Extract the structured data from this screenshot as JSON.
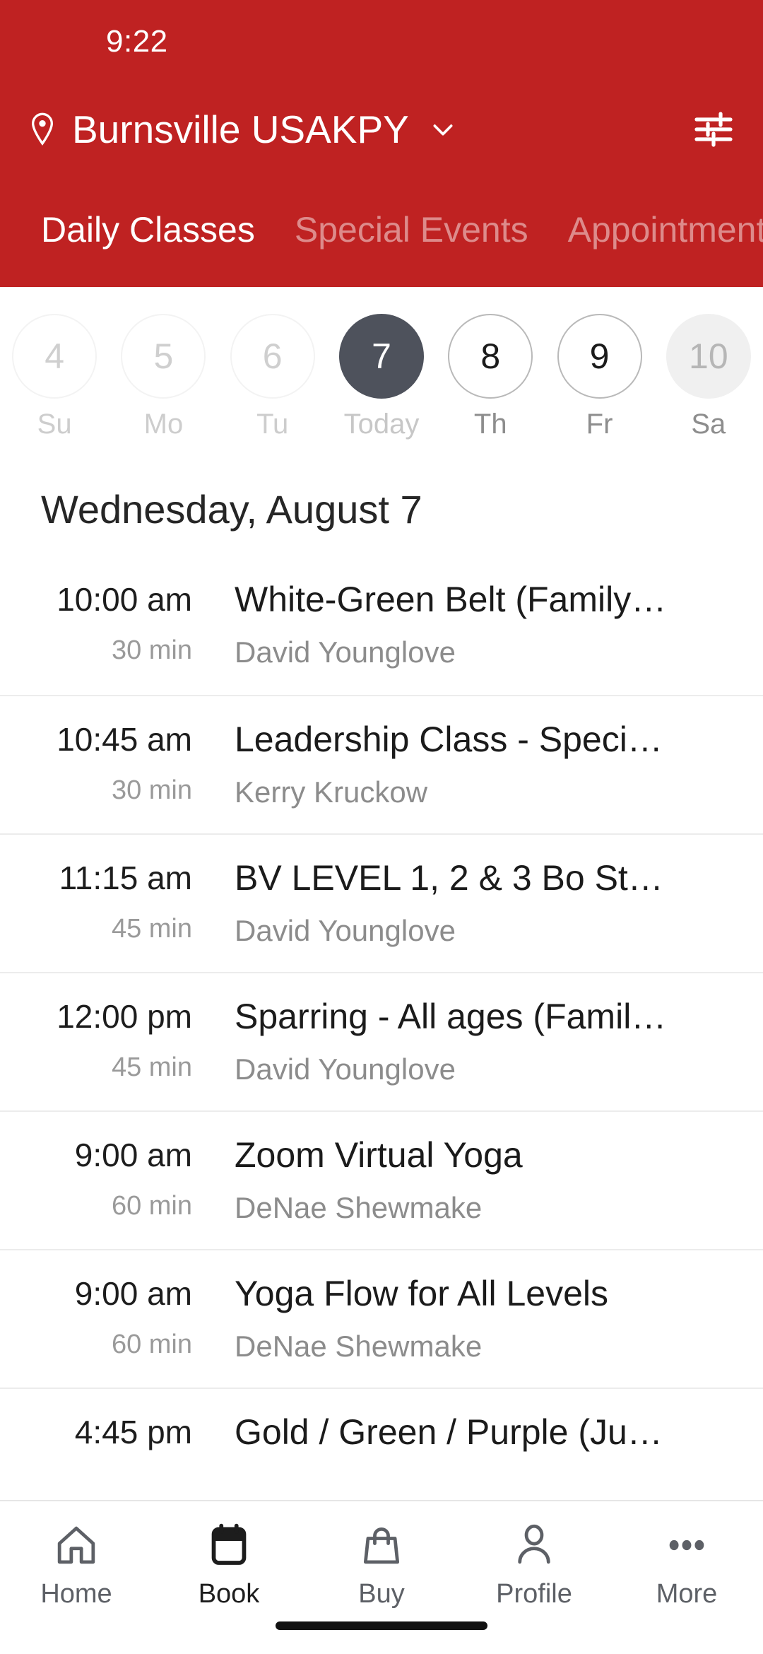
{
  "status_bar": {
    "time": "9:22"
  },
  "header": {
    "background_color": "#bf2222",
    "location_name": "Burnsville USAKPY",
    "location_pin_icon": "map-pin-icon",
    "location_chevron_icon": "chevron-down-icon",
    "filter_icon": "tune-filter-icon",
    "tabs": [
      {
        "label": "Daily Classes",
        "active": true
      },
      {
        "label": "Special Events",
        "active": false
      },
      {
        "label": "Appointments",
        "active": false
      }
    ]
  },
  "date_strip": {
    "days": [
      {
        "number": "4",
        "label": "Su",
        "state": "past"
      },
      {
        "number": "5",
        "label": "Mo",
        "state": "past"
      },
      {
        "number": "6",
        "label": "Tu",
        "state": "past"
      },
      {
        "number": "7",
        "label": "Today",
        "state": "today"
      },
      {
        "number": "8",
        "label": "Th",
        "state": "future"
      },
      {
        "number": "9",
        "label": "Fr",
        "state": "future"
      },
      {
        "number": "10",
        "label": "Sa",
        "state": "pressed"
      }
    ],
    "selected_color": "#4e525c"
  },
  "schedule": {
    "heading": "Wednesday, August 7",
    "classes": [
      {
        "time": "10:00 am",
        "duration": "30 min",
        "title": "White-Green Belt (Family…",
        "staff": "David Younglove"
      },
      {
        "time": "10:45 am",
        "duration": "30 min",
        "title": "Leadership Class - Speci…",
        "staff": "Kerry Kruckow"
      },
      {
        "time": "11:15 am",
        "duration": "45 min",
        "title": "BV LEVEL 1, 2 & 3 Bo St…",
        "staff": "David Younglove"
      },
      {
        "time": "12:00 pm",
        "duration": "45 min",
        "title": "Sparring - All ages (Famil…",
        "staff": "David Younglove"
      },
      {
        "time": "9:00 am",
        "duration": "60 min",
        "title": "Zoom Virtual Yoga",
        "staff": "DeNae Shewmake"
      },
      {
        "time": "9:00 am",
        "duration": "60 min",
        "title": "Yoga Flow for All Levels",
        "staff": "DeNae Shewmake"
      },
      {
        "time": "4:45 pm",
        "duration": "",
        "title": "Gold / Green / Purple (Ju…",
        "staff": ""
      }
    ]
  },
  "bottom_nav": {
    "items": [
      {
        "label": "Home",
        "icon": "home-icon",
        "active": false
      },
      {
        "label": "Book",
        "icon": "calendar-icon",
        "active": true
      },
      {
        "label": "Buy",
        "icon": "shopping-bag-icon",
        "active": false
      },
      {
        "label": "Profile",
        "icon": "person-icon",
        "active": false
      },
      {
        "label": "More",
        "icon": "ellipsis-icon",
        "active": false
      }
    ]
  }
}
